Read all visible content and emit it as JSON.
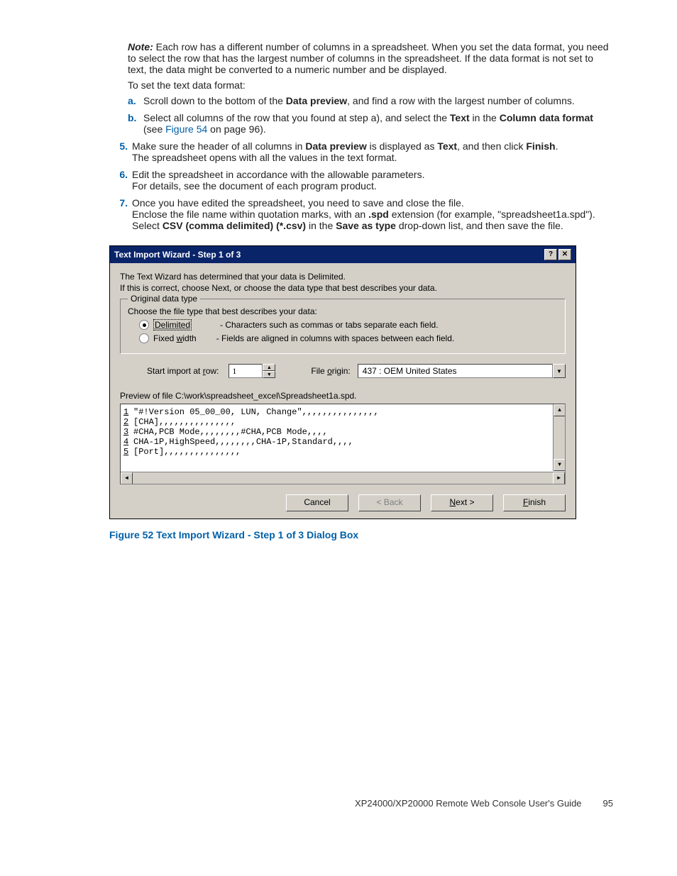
{
  "note": {
    "label": "Note:",
    "text": " Each row has a different number of columns in a spreadsheet. When you set the data format, you need to select the row that has the largest number of columns in the spreadsheet. If the data format is not set to text, the data might be converted to a numeric number and be displayed."
  },
  "intro_after_note": "To set the text data format:",
  "sub": {
    "a_marker": "a.",
    "a_pre": "Scroll down to the bottom of the ",
    "a_bold": "Data preview",
    "a_post": ", and find a row with the largest number of columns.",
    "b_marker": "b.",
    "b_pre": "Select all columns of the row that you found at step a), and select the ",
    "b_bold1": "Text",
    "b_mid": " in the ",
    "b_bold2": "Column data format",
    "b_post1": " (see ",
    "b_link": "Figure 54",
    "b_post2": " on page 96)."
  },
  "steps": {
    "s5_marker": "5.",
    "s5_pre": "Make sure the header of all columns in ",
    "s5_b1": "Data preview",
    "s5_mid": " is displayed as ",
    "s5_b2": "Text",
    "s5_mid2": ", and then click ",
    "s5_b3": "Finish",
    "s5_post": ".",
    "s5_line2": "The spreadsheet opens with all the values in the text format.",
    "s6_marker": "6.",
    "s6_line1": "Edit the spreadsheet in accordance with the allowable parameters.",
    "s6_line2": "For details, see the document of each program product.",
    "s7_marker": "7.",
    "s7_line1": "Once you have edited the spreadsheet, you need to save and close the file.",
    "s7_l2_pre": "Enclose the file name within quotation marks, with an ",
    "s7_l2_b1": ".spd",
    "s7_l2_mid": " extension (for example, \"spreadsheet1a.spd\"). Select ",
    "s7_l2_b2": "CSV (comma delimited) (*.csv)",
    "s7_l2_mid2": " in the ",
    "s7_l2_b3": "Save as type",
    "s7_l2_post": " drop-down list, and then save the file."
  },
  "dialog": {
    "title": "Text Import Wizard - Step 1 of 3",
    "intro1": "The Text Wizard has determined that your data is Delimited.",
    "intro2": "If this is correct, choose Next, or choose the data type that best describes your data.",
    "fieldset_legend": "Original data type",
    "choose_line": "Choose the file type that best describes your data:",
    "radio1_label": "Delimited",
    "radio1_desc": "- Characters such as commas or tabs separate each field.",
    "radio2_label_pre": "Fixed ",
    "radio2_label_u": "w",
    "radio2_label_post": "idth",
    "radio2_desc": "- Fields are aligned in columns with spaces between each field.",
    "start_row_lbl_pre": "Start import at ",
    "start_row_lbl_u": "r",
    "start_row_lbl_post": "ow:",
    "start_row_val": "1",
    "file_origin_lbl_pre": "File ",
    "file_origin_lbl_u": "o",
    "file_origin_lbl_post": "rigin:",
    "file_origin_val": "437 : OEM United States",
    "preview_label": "Preview of file C:\\work\\spreadsheet_excel\\Spreadsheet1a.spd.",
    "preview_rows": [
      {
        "n": "1",
        "t": "\"#!Version 05_00_00, LUN, Change\",,,,,,,,,,,,,,,"
      },
      {
        "n": "2",
        "t": "[CHA],,,,,,,,,,,,,,,"
      },
      {
        "n": "3",
        "t": "#CHA,PCB Mode,,,,,,,,#CHA,PCB Mode,,,,"
      },
      {
        "n": "4",
        "t": "CHA-1P,HighSpeed,,,,,,,,CHA-1P,Standard,,,,"
      },
      {
        "n": "5",
        "t": "[Port],,,,,,,,,,,,,,,"
      }
    ],
    "btn_cancel": "Cancel",
    "btn_back": "< Back",
    "btn_next_u": "N",
    "btn_next_post": "ext >",
    "btn_finish_u": "F",
    "btn_finish_post": "inish"
  },
  "figure_caption": "Figure 52 Text Import Wizard - Step 1 of 3 Dialog Box",
  "footer": {
    "guide": "XP24000/XP20000 Remote Web Console User's Guide",
    "page": "95"
  }
}
